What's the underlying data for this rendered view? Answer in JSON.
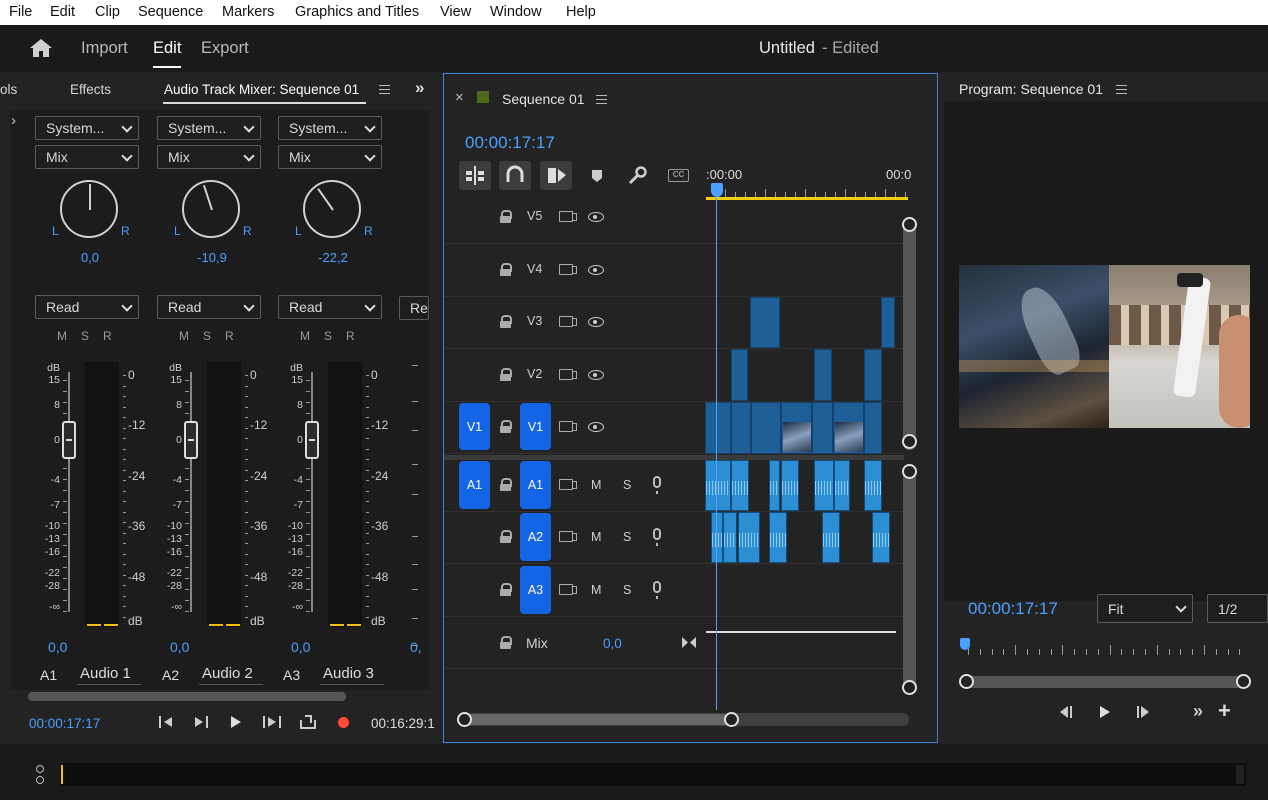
{
  "menu": [
    "File",
    "Edit",
    "Clip",
    "Sequence",
    "Markers",
    "Graphics and Titles",
    "View",
    "Window",
    "Help"
  ],
  "header": {
    "tabs": [
      "Import",
      "Edit",
      "Export"
    ],
    "active_tab": "Edit",
    "project_title": "Untitled",
    "project_status": "- Edited"
  },
  "mixer_panel": {
    "tabs": [
      "ols",
      "Effects",
      "Audio Track Mixer: Sequence 01"
    ],
    "channels": [
      {
        "input": "System...",
        "mode": "Mix",
        "pan": "0,0",
        "automation": "Read",
        "volume": "0,0",
        "track_id": "A1",
        "track_name": "Audio 1",
        "knob_angle": 0
      },
      {
        "input": "System...",
        "mode": "Mix",
        "pan": "-10,9",
        "automation": "Read",
        "volume": "0,0",
        "track_id": "A2",
        "track_name": "Audio 2",
        "knob_angle": -18
      },
      {
        "input": "System...",
        "mode": "Mix",
        "pan": "-22,2",
        "automation": "Read",
        "volume": "0,0",
        "track_id": "A3",
        "track_name": "Audio 3",
        "knob_angle": -35
      }
    ],
    "partial_channel": {
      "automation": "Re",
      "volume": "0,"
    },
    "msr": "MSR",
    "fader_scale": [
      "dB",
      "15",
      "8",
      "0",
      "-4",
      "-7",
      "-10",
      "-13",
      "-16",
      "-22",
      "-28",
      "-∞"
    ],
    "meter_scale": [
      "0",
      "-12",
      "-24",
      "-36",
      "-48",
      "dB"
    ],
    "timecode_left": "00:00:17:17",
    "timecode_right": "00:16:29:1"
  },
  "timeline": {
    "tab": "Sequence 01",
    "close": "×",
    "timecode": "00:00:17:17",
    "ruler_start": ":00:00",
    "ruler_end": "00:0",
    "tracks": {
      "video": [
        "V5",
        "V4",
        "V3",
        "V2",
        "V1"
      ],
      "audio": [
        "A1",
        "A2",
        "A3"
      ],
      "source_v1": "V1",
      "source_a1": "A1",
      "m": "M",
      "s": "S",
      "mix_label": "Mix",
      "mix_value": "0,0"
    }
  },
  "program": {
    "title": "Program: Sequence 01",
    "timecode": "00:00:17:17",
    "fit": "Fit",
    "resolution": "1/2"
  },
  "colors": {
    "accent": "#4a9fff",
    "track_button": "#1464e6",
    "video_clip": "#1e5f98",
    "audio_clip": "#2c8fd4",
    "work_area": "#f0d000"
  }
}
